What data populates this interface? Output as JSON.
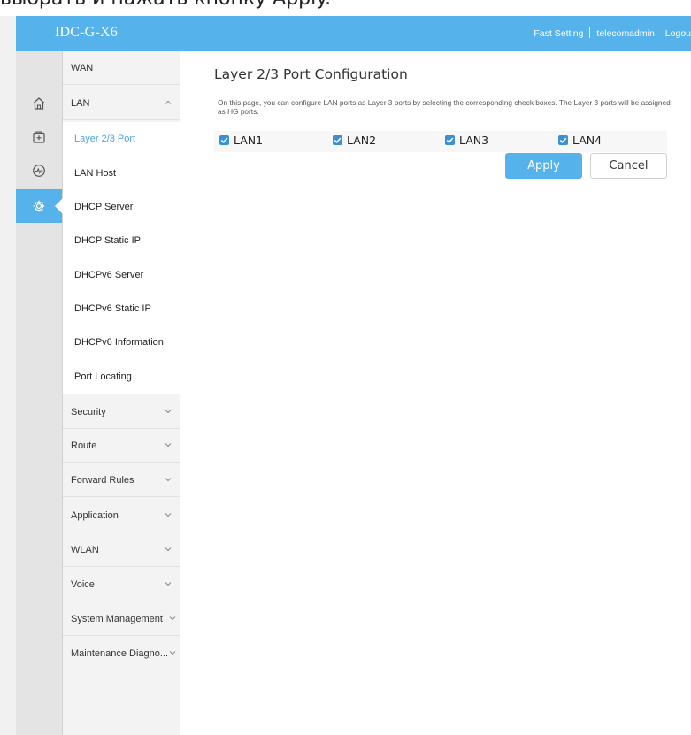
{
  "caption": "выбрать и нажать кнопку Apply.",
  "header": {
    "brand": "IDC-G-X6",
    "fast_setting": "Fast Setting",
    "user": "telecomadmin",
    "logout": "Logou"
  },
  "iconbar": {
    "items": [
      {
        "icon": "home-icon"
      },
      {
        "icon": "plus-box-icon"
      },
      {
        "icon": "pulse-icon"
      },
      {
        "icon": "gear-icon",
        "active": true
      }
    ]
  },
  "menu": {
    "wan": "WAN",
    "lan": "LAN",
    "lan_subitems": [
      "Layer 2/3 Port",
      "LAN Host",
      "DHCP Server",
      "DHCP Static IP",
      "DHCPv6 Server",
      "DHCPv6 Static IP",
      "DHCPv6 Information",
      "Port Locating"
    ],
    "groups": [
      "Security",
      "Route",
      "Forward Rules",
      "Application",
      "WLAN",
      "Voice",
      "System Management",
      "Maintenance Diagno..."
    ]
  },
  "content": {
    "title": "Layer 2/3 Port Configuration",
    "description": "On this page, you can configure LAN ports as Layer 3 ports by selecting the corresponding check boxes. The Layer 3 ports will be assigned as HG ports.",
    "ports": [
      {
        "label": "LAN1",
        "checked": true
      },
      {
        "label": "LAN2",
        "checked": true
      },
      {
        "label": "LAN3",
        "checked": true
      },
      {
        "label": "LAN4",
        "checked": true
      }
    ],
    "apply_label": "Apply",
    "cancel_label": "Cancel"
  },
  "colors": {
    "accent": "#56b2ea",
    "checkbox": "#3a8fd6",
    "active_link": "#4aa7e4"
  }
}
